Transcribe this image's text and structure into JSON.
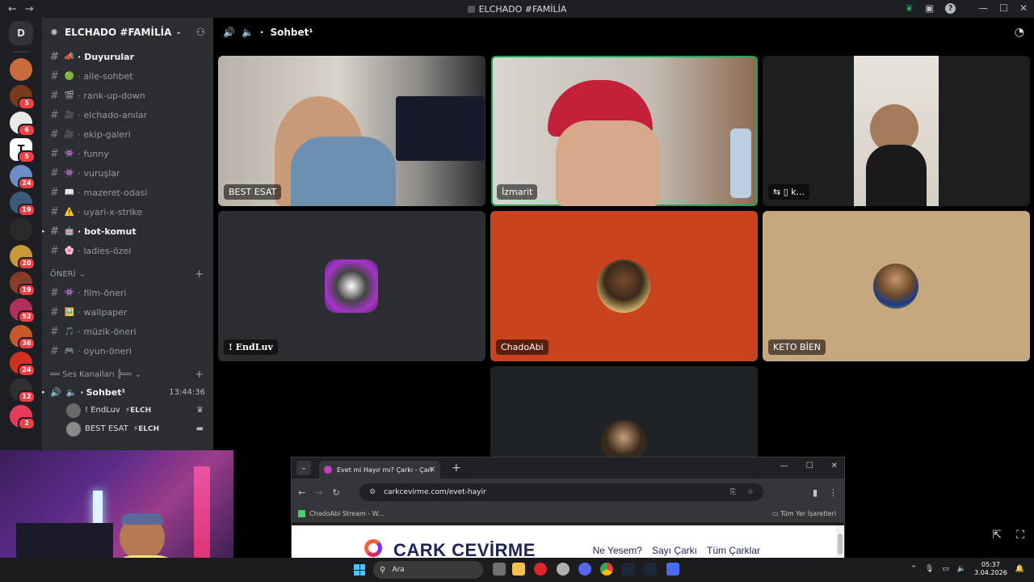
{
  "window": {
    "title": "ELCHADO #FAMİLİA",
    "back": "←",
    "forward": "→",
    "help": "?"
  },
  "rail": {
    "home_label": "D",
    "servers": [
      {
        "color": "#c96b3a",
        "badge": ""
      },
      {
        "color": "#7a3a1a",
        "badge": "5"
      },
      {
        "color": "#e9e9e9",
        "badge": "6"
      },
      {
        "color": "#ffffff",
        "badge": "5",
        "letter": "T"
      },
      {
        "color": "#6a8fc8",
        "badge": "24"
      },
      {
        "color": "#3a5a7a",
        "badge": "19"
      },
      {
        "color": "#2a2a2a",
        "badge": ""
      },
      {
        "color": "#c89a3a",
        "badge": "20"
      },
      {
        "color": "#8a3a2a",
        "badge": "19"
      },
      {
        "color": "#b0305a",
        "badge": "52"
      },
      {
        "color": "#c85a2a",
        "badge": "36"
      },
      {
        "color": "#d03020",
        "badge": "24"
      },
      {
        "color": "#303030",
        "badge": "12"
      },
      {
        "color": "#e83a5a",
        "badge": "2"
      }
    ]
  },
  "sidebar": {
    "server_name": "ELCHADO #FAMİLİA",
    "channels": [
      {
        "emoji": "📣",
        "name": "Duyurular",
        "bold": true
      },
      {
        "emoji": "🟢",
        "name": "aile-sohbet",
        "bold": false
      },
      {
        "emoji": "🎬",
        "name": "rank-up-down",
        "bold": false
      },
      {
        "emoji": "🎥",
        "name": "elchado-anılar",
        "bold": false
      },
      {
        "emoji": "🎥",
        "name": "ekip-galeri",
        "bold": false
      },
      {
        "emoji": "👾",
        "name": "funny",
        "bold": false
      },
      {
        "emoji": "👾",
        "name": "vuruşlar",
        "bold": false
      },
      {
        "emoji": "📖",
        "name": "mazeret-odasi",
        "bold": false
      },
      {
        "emoji": "⚠️",
        "name": "uyari-x-strike",
        "bold": false
      },
      {
        "emoji": "🤖",
        "name": "bot-komut",
        "bold": true
      },
      {
        "emoji": "🌸",
        "name": "ladies-özel",
        "bold": false
      }
    ],
    "category_oneri": "ÖNERİ",
    "oneri_channels": [
      {
        "emoji": "👾",
        "name": "film-öneri"
      },
      {
        "emoji": "🖼️",
        "name": "wallpaper"
      },
      {
        "emoji": "🎵",
        "name": "müzik-öneri"
      },
      {
        "emoji": "🎮",
        "name": "oyun-öneri"
      }
    ],
    "category_voice": "══ Ses Kanalları ╠══",
    "voice_channel": {
      "name": "Sohbet",
      "sup": "¹",
      "timer": "13:44:36"
    },
    "voice_users": [
      {
        "name": "! EndLuv",
        "tag": "⚡ELCH",
        "right": "♛",
        "color": "#6a6a6a"
      },
      {
        "name": "BEST ESAT",
        "tag": "⚡ELCH",
        "right": "▬",
        "color": "#8a8a8a"
      }
    ]
  },
  "main": {
    "channel_title": "Sohbet",
    "channel_sup": "¹",
    "participants": [
      {
        "name": "BEST ESAT",
        "type": "video"
      },
      {
        "name": "İzmarit",
        "type": "video",
        "speaking": true
      },
      {
        "name": "k...",
        "type": "video",
        "prefix": "⇆ ▯ "
      },
      {
        "name": "! EndLuv",
        "type": "avatar",
        "bg": "#2b2d31"
      },
      {
        "name": "ChadoAbi",
        "type": "avatar",
        "bg": "#c9431f"
      },
      {
        "name": "KETO BİEN",
        "type": "avatar",
        "bg": "#c7a77e"
      }
    ]
  },
  "browser": {
    "tab_title": "Evet mi Hayır mı? Çarkı - Çark Çev...",
    "url": "carkcevirme.com/evet-hayir",
    "bookmark": "ChadoAbi Stream - W...",
    "all_bookmarks": "Tüm Yer İşaretleri",
    "page_logo": "CARK CEVİRME",
    "page_nav": [
      "Ne Yesem?",
      "Sayı Çarkı",
      "Tüm Çarklar"
    ]
  },
  "taskbar": {
    "search_placeholder": "Ara",
    "time": "05:37",
    "date": "3.04.2026"
  }
}
